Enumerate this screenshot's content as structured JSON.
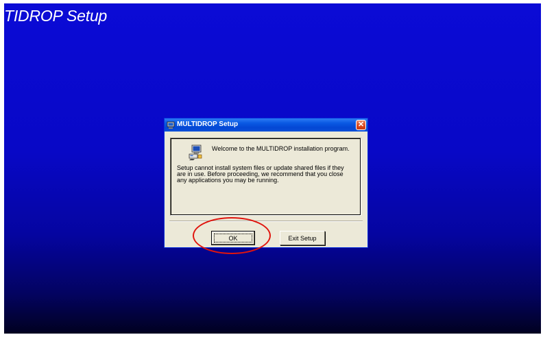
{
  "background": {
    "title": "TIDROP Setup",
    "gradient_top": "#0b0bd6",
    "gradient_bottom": "#010120"
  },
  "dialog": {
    "title": "MULTIDROP Setup",
    "title_icon": "setup-app-icon",
    "close_icon": "close-icon",
    "welcome": "Welcome to the MULTIDROP installation program.",
    "body_lines": [
      "Setup cannot install system files or update shared files if they",
      "are in use.  Before proceeding, we recommend that you close",
      "any applications you may be running."
    ],
    "content_icon": "computer-setup-icon",
    "buttons": {
      "ok": "OK",
      "exit": "Exit Setup"
    }
  },
  "annotation": {
    "type": "ellipse",
    "color": "#e0150e",
    "target": "ok-button"
  }
}
